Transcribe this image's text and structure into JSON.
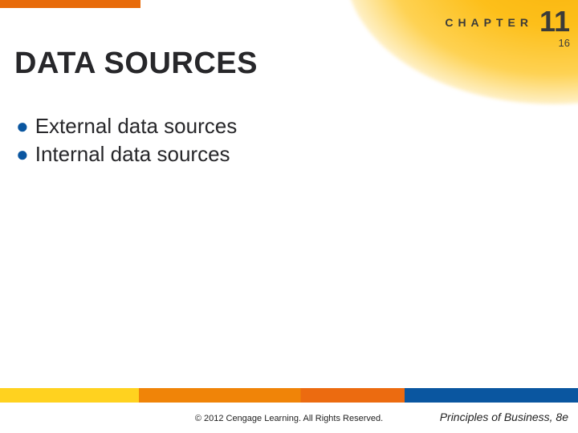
{
  "chapter": {
    "label": "CHAPTER",
    "number": "11"
  },
  "slide_number": "16",
  "title": "DATA SOURCES",
  "bullets": [
    "External data sources",
    "Internal data sources"
  ],
  "footer": {
    "copyright": "© 2012 Cengage Learning. All Rights Reserved.",
    "book": "Principles of Business, 8e"
  }
}
